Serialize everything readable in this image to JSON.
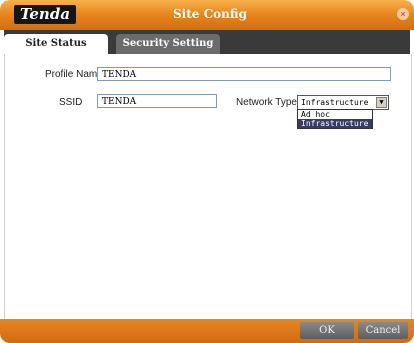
{
  "titlebar": {
    "logo": "Tenda",
    "title": "Site Config",
    "close_glyph": "×"
  },
  "tabs": [
    {
      "label": "Site Status",
      "active": true
    },
    {
      "label": "Security Setting",
      "active": false
    }
  ],
  "form": {
    "profile_label": "Profile Name",
    "profile_value": "TENDA",
    "ssid_label": "SSID",
    "ssid_value": "TENDA",
    "network_type_label": "Network Type",
    "network_type_value": "Infrastructure",
    "network_type_options": [
      "Ad hoc",
      "Infrastructure"
    ]
  },
  "buttons": {
    "ok": "OK",
    "cancel": "Cancel"
  },
  "colors": {
    "accent": "#e8871f",
    "tab_bar": "#3a3a3a",
    "button": "#6b6b6b"
  }
}
